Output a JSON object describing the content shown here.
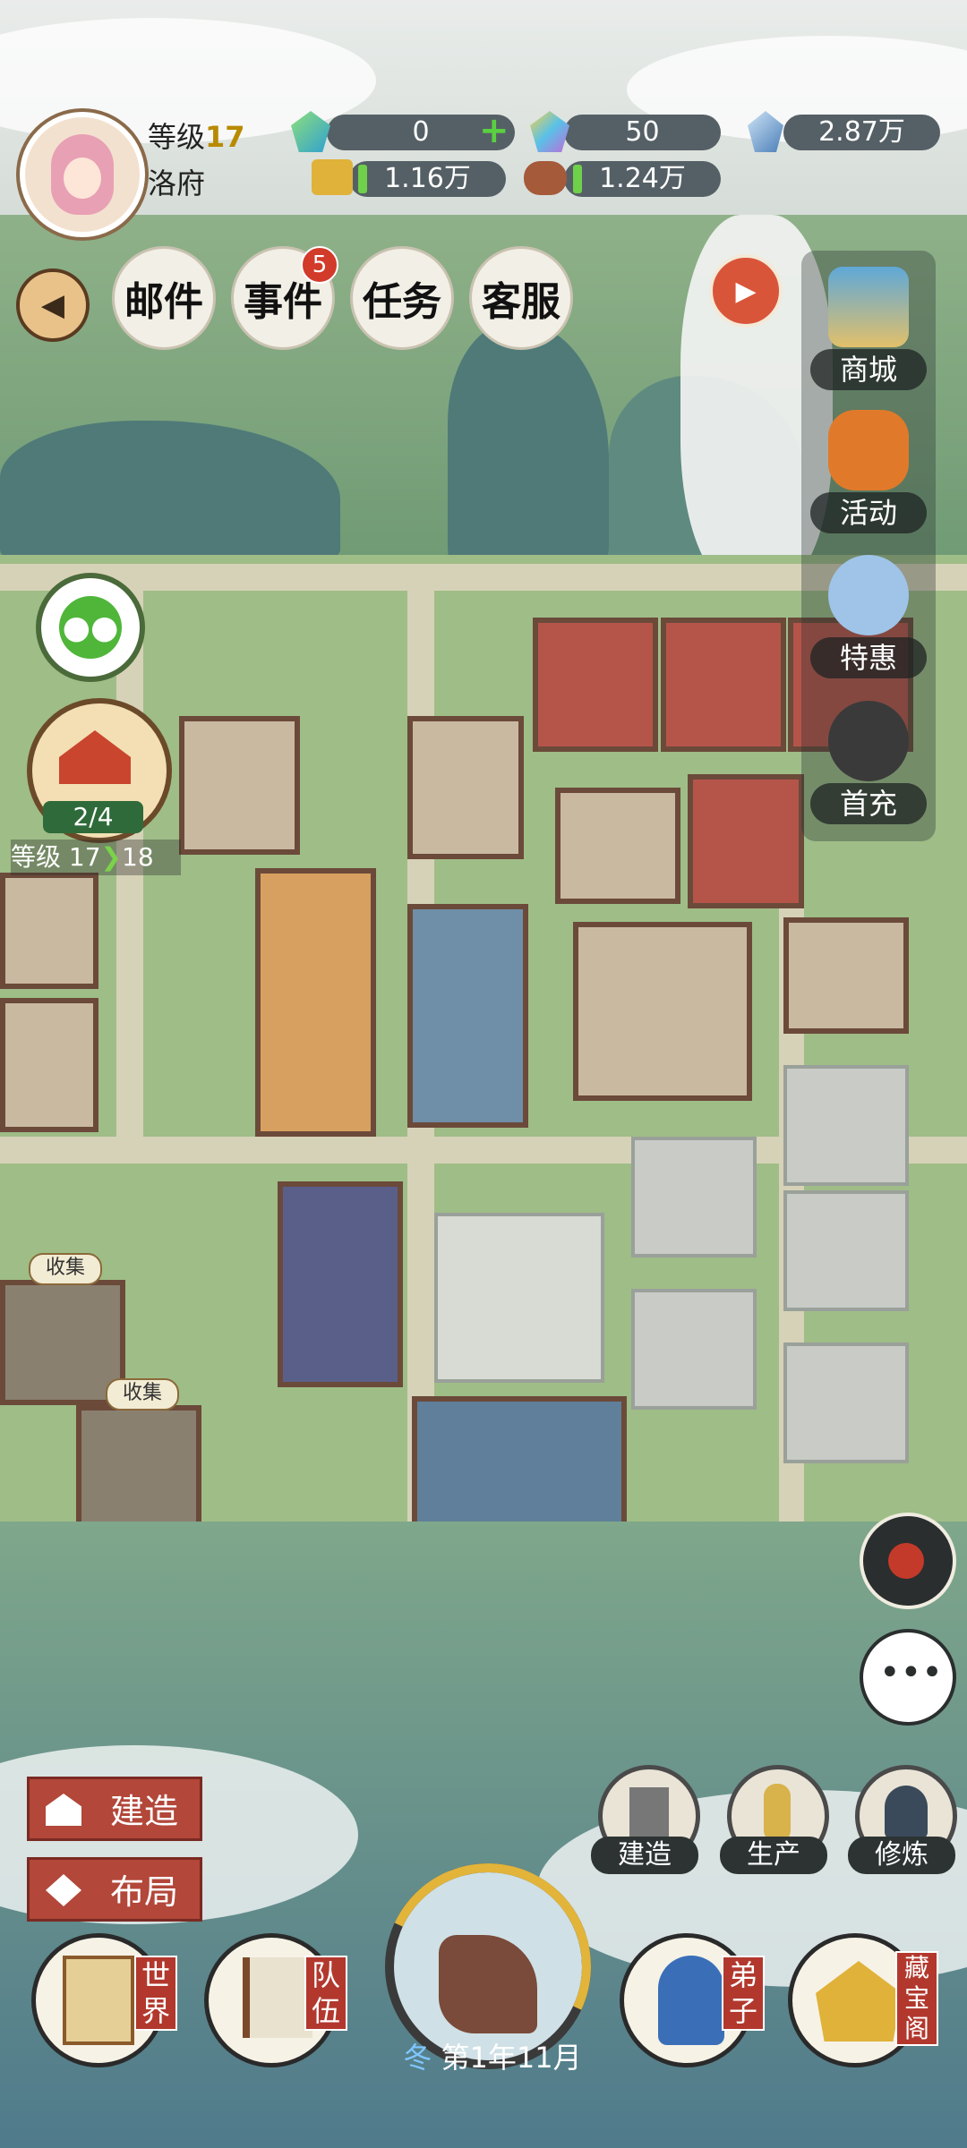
{
  "player": {
    "level_label": "等级",
    "level_value": "17",
    "name": "洛府"
  },
  "resources": {
    "gem_green": "0",
    "gem_rainbow": "50",
    "crystal": "2.87万",
    "gold": "1.16万",
    "wood": "1.24万"
  },
  "top_actions": [
    {
      "label": "邮件"
    },
    {
      "label": "事件",
      "badge": "5"
    },
    {
      "label": "任务"
    },
    {
      "label": "客服"
    }
  ],
  "right_menu": [
    {
      "label": "商城",
      "icon": "shop-icon"
    },
    {
      "label": "活动",
      "icon": "lantern-icon"
    },
    {
      "label": "特惠",
      "icon": "discount-girl-icon"
    },
    {
      "label": "首充",
      "icon": "first-recharge-icon"
    }
  ],
  "sect": {
    "progress": "2/4",
    "level_from": "等级 17",
    "level_to": "18"
  },
  "collect_label": "收集",
  "build_menu": {
    "build": "建造",
    "layout": "布局"
  },
  "managers": [
    {
      "label": "建造",
      "icon": "hammer-icon"
    },
    {
      "label": "生产",
      "icon": "wheat-icon"
    },
    {
      "label": "修炼",
      "icon": "cultivator-icon"
    }
  ],
  "bottom_nav": [
    {
      "label": "世界",
      "icon": "scroll-map-icon"
    },
    {
      "label": "队伍",
      "icon": "flag-icon"
    },
    {
      "label": "弟子",
      "icon": "disciple-icon"
    },
    {
      "label": "藏宝阁",
      "icon": "treasure-pavilion-icon"
    }
  ],
  "calendar": {
    "season": "冬",
    "date": "第1年11月"
  },
  "colors": {
    "accent_red": "#b2473a",
    "badge_red": "#d23a2a",
    "resource_bar": "#556066",
    "level_gold": "#b88a00"
  }
}
